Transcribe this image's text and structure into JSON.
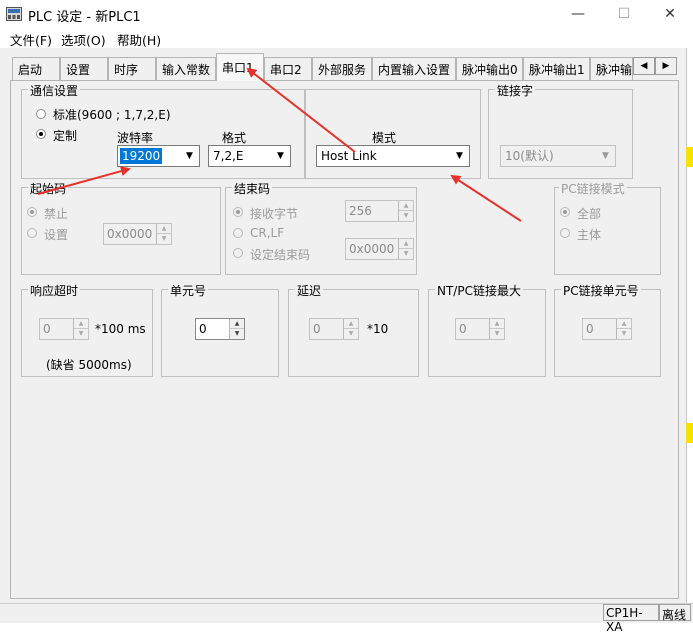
{
  "window": {
    "title": "PLC 设定 - 新PLC1",
    "minimize_glyph": "—",
    "maximize_glyph": "☐",
    "close_glyph": "✕"
  },
  "menu": [
    "文件(F)",
    "选项(O)",
    "帮助(H)"
  ],
  "tabs": [
    "启动",
    "设置",
    "时序",
    "输入常数",
    "串口1",
    "串口2",
    "外部服务",
    "内置输入设置",
    "脉冲输出0",
    "脉冲输出1",
    "脉冲输出"
  ],
  "active_tab": "串口1",
  "tab_scroll": {
    "left": "◀",
    "right": "▶"
  },
  "comm": {
    "group_label": "通信设置",
    "standard_label": "标准(9600 ; 1,7,2,E)",
    "custom_label": "定制",
    "baud_label": "波特率",
    "baud_value": "19200",
    "format_label": "格式",
    "format_value": "7,2,E",
    "mode_label": "模式",
    "mode_value": "Host Link"
  },
  "link_word": {
    "group_label": "链接字",
    "value": "10(默认)"
  },
  "start_code": {
    "group_label": "起始码",
    "disable_label": "禁止",
    "set_label": "设置",
    "value": "0x0000"
  },
  "end_code": {
    "group_label": "结束码",
    "recv_bytes_label": "接收字节",
    "recv_bytes_value": "256",
    "crlf_label": "CR,LF",
    "set_end_label": "设定结束码",
    "end_value": "0x0000"
  },
  "pc_link_mode": {
    "group_label": "PC链接模式",
    "all_label": "全部",
    "master_label": "主体"
  },
  "response_timeout": {
    "group_label": "响应超时",
    "value": "0",
    "unit": "*100 ms",
    "note": "(缺省 5000ms)"
  },
  "unit_no": {
    "group_label": "单元号",
    "value": "0"
  },
  "delay": {
    "group_label": "延迟",
    "value": "0",
    "unit": "*10"
  },
  "nt_pc_max": {
    "group_label": "NT/PC链接最大",
    "value": "0"
  },
  "pc_link_unit": {
    "group_label": "PC链接单元号",
    "value": "0"
  },
  "status": {
    "model": "CP1H-XA",
    "mode": "离线"
  },
  "colors": {
    "annotation_arrow": "#e8312a",
    "selection": "#0078d7",
    "yellow_mark": "#f7e300"
  }
}
